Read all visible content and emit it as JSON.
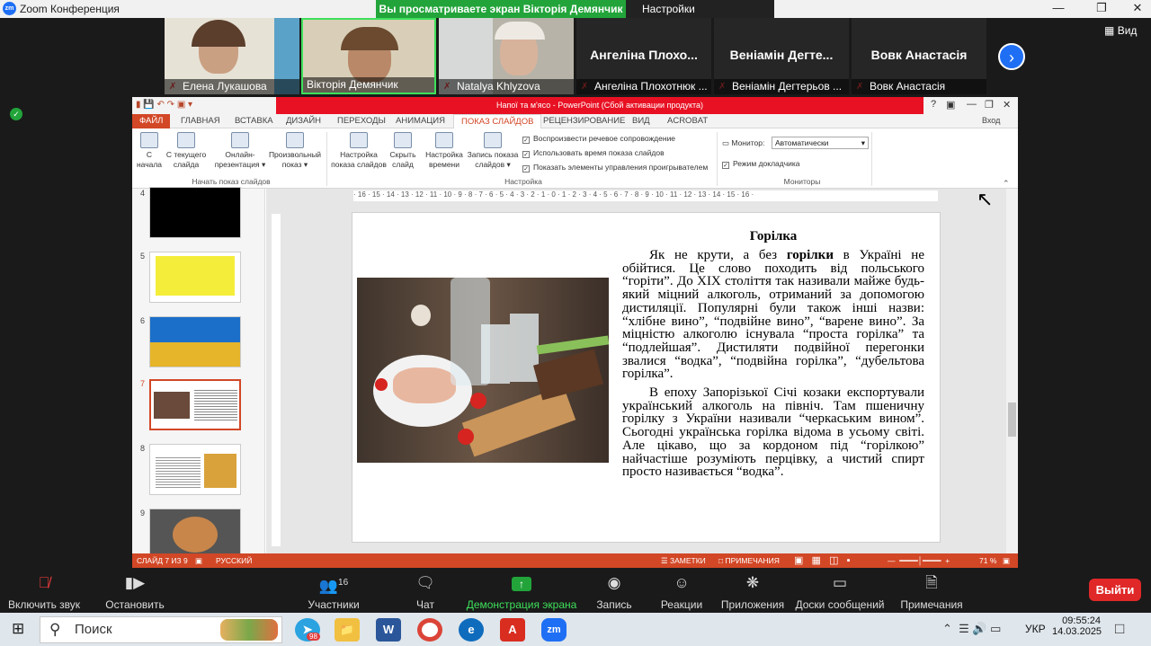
{
  "zoom": {
    "window_title": "Zoom Конференция",
    "share_banner": "Вы просматриваете экран Вікторія Демянчик",
    "view_settings": "Настройки просмотра",
    "view_button": "Вид",
    "participants": [
      {
        "name": "Елена Лукашова",
        "has_video": true
      },
      {
        "name": "Вікторія Демянчик",
        "has_video": true
      },
      {
        "name": "Natalya Khlyzova",
        "has_video": true
      },
      {
        "name": "Ангеліна Плохотнюк ...",
        "display": "Ангеліна  Плохо...",
        "has_video": false
      },
      {
        "name": "Веніамін Дегтерьов ...",
        "display": "Веніамін  Дегте...",
        "has_video": false
      },
      {
        "name": "Вовк Анастасія",
        "display": "Вовк Анастасія",
        "has_video": false
      }
    ],
    "toolbar": {
      "unmute": "Включить звук",
      "start_video": "Остановить видео",
      "participants": "Участники",
      "participants_count": "16",
      "chat": "Чат",
      "share_screen": "Демонстрация экрана",
      "record": "Запись",
      "reactions": "Реакции",
      "apps": "Приложения",
      "whiteboards": "Доски сообщений",
      "notes": "Примечания",
      "leave": "Выйти"
    }
  },
  "powerpoint": {
    "title": "Напої та м'ясо -  PowerPoint (Сбой активации продукта)",
    "signin": "Вход",
    "tabs": [
      "ФАЙЛ",
      "ГЛАВНАЯ",
      "ВСТАВКА",
      "ДИЗАЙН",
      "ПЕРЕХОДЫ",
      "АНИМАЦИЯ",
      "ПОКАЗ СЛАЙДОВ",
      "РЕЦЕНЗИРОВАНИЕ",
      "ВИД",
      "ACROBAT"
    ],
    "active_tab": "ПОКАЗ СЛАЙДОВ",
    "ribbon": {
      "from_start": [
        "С",
        "начала"
      ],
      "from_current": [
        "С текущего",
        "слайда"
      ],
      "online": [
        "Онлайн-",
        "презентация ▾"
      ],
      "custom": [
        "Произвольный",
        "показ ▾"
      ],
      "group_start": "Начать показ слайдов",
      "setup_show": [
        "Настройка",
        "показа слайдов"
      ],
      "hide_slide": [
        "Скрыть",
        "слайд"
      ],
      "rehearse": [
        "Настройка",
        "времени"
      ],
      "record_show": [
        "Запись показа",
        "слайдов ▾"
      ],
      "group_setup": "Настройка",
      "checks": [
        "Воспроизвести речевое сопровождение",
        "Использовать время показа слайдов",
        "Показать элементы управления проигрывателем"
      ],
      "monitor_label": "Монитор:",
      "monitor_value": "Автоматически",
      "presenter_view": "Режим докладчика",
      "group_monitors": "Мониторы"
    },
    "thumbnails": [
      "4",
      "5",
      "6",
      "7",
      "8",
      "9"
    ],
    "selected_slide": "7",
    "ruler": "· 16 · 15 · 14 · 13 · 12 · 11 · 10 · 9 · 8 · 7 · 6 · 5 · 4 · 3 · 2 · 1 · 0 · 1 · 2 · 3 · 4 · 5 · 6 · 7 · 8 · 9 · 10 · 11 · 12 · 13 · 14 · 15 · 16 ·",
    "slide": {
      "title": "Горілка",
      "p1_a": "Як не крути, а без ",
      "p1_b": "горілки",
      "p1_c": " в Україні не обійтися. Це слово походить від польського “горіти”. До XIX століття так називали майже будь-який міцний алкоголь, отриманий за допомогою дистиляції. Популярні були також інші назви: “хлібне вино”, “подвійне вино”, “варене вино”. За міцністю алкоголю існувала “проста горілка” та “подлейшая”. Дистиляти подвійної перегонки звалися “водка”, “подвійна горілка”, “дубельтова горілка”.",
      "p2": "В епоху Запорізької Січі козаки експортували український алкоголь на північ. Там пшеничну горілку з України називали “черкаським вином”. Сьогодні українська горілка відома в усьому світі. Але цікаво, що за кордоном під “горілкою” найчастіше розуміють перцівку, а чистий спирт просто називається “водка”."
    },
    "status": {
      "slide_of": "СЛАЙД 7 ИЗ 9",
      "language": "РУССКИЙ",
      "notes": "ЗАМЕТКИ",
      "comments": "ПРИМЕЧАНИЯ",
      "zoom": "71 %"
    }
  },
  "taskbar": {
    "search": "Поиск",
    "telegram_badge": "98",
    "lang": "УКР",
    "time": "09:55:24",
    "date": "14.03.2025"
  }
}
